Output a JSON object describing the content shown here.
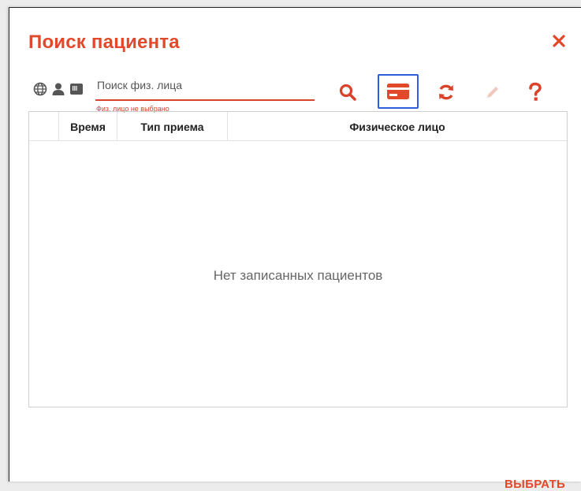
{
  "dialog": {
    "title": "Поиск пациента",
    "close_icon": "close-icon",
    "accent_color": "#e2482a",
    "selected_outline_color": "#2e5de0"
  },
  "sources": [
    {
      "icon": "globe-icon"
    },
    {
      "icon": "person-icon"
    },
    {
      "icon": "card-reader-icon"
    }
  ],
  "search": {
    "placeholder": "Поиск физ. лица",
    "value": "",
    "hint": "Физ. лицо не выбрано"
  },
  "toolbar": [
    {
      "icon": "search-icon",
      "color": "#d9432b"
    },
    {
      "icon": "card-icon",
      "color": "#e2482a",
      "selected": true
    },
    {
      "icon": "refresh-icon",
      "color": "#d9432b"
    },
    {
      "icon": "pencil-icon",
      "color": "#f1c8bd",
      "disabled": true
    },
    {
      "icon": "help-icon",
      "color": "#d9432b"
    }
  ],
  "table": {
    "columns": [
      "",
      "Время",
      "Тип приема",
      "Физическое лицо"
    ],
    "rows": [],
    "empty_text": "Нет записанных пациентов"
  },
  "footer": {
    "choose_label": "ВЫБРАТЬ"
  }
}
